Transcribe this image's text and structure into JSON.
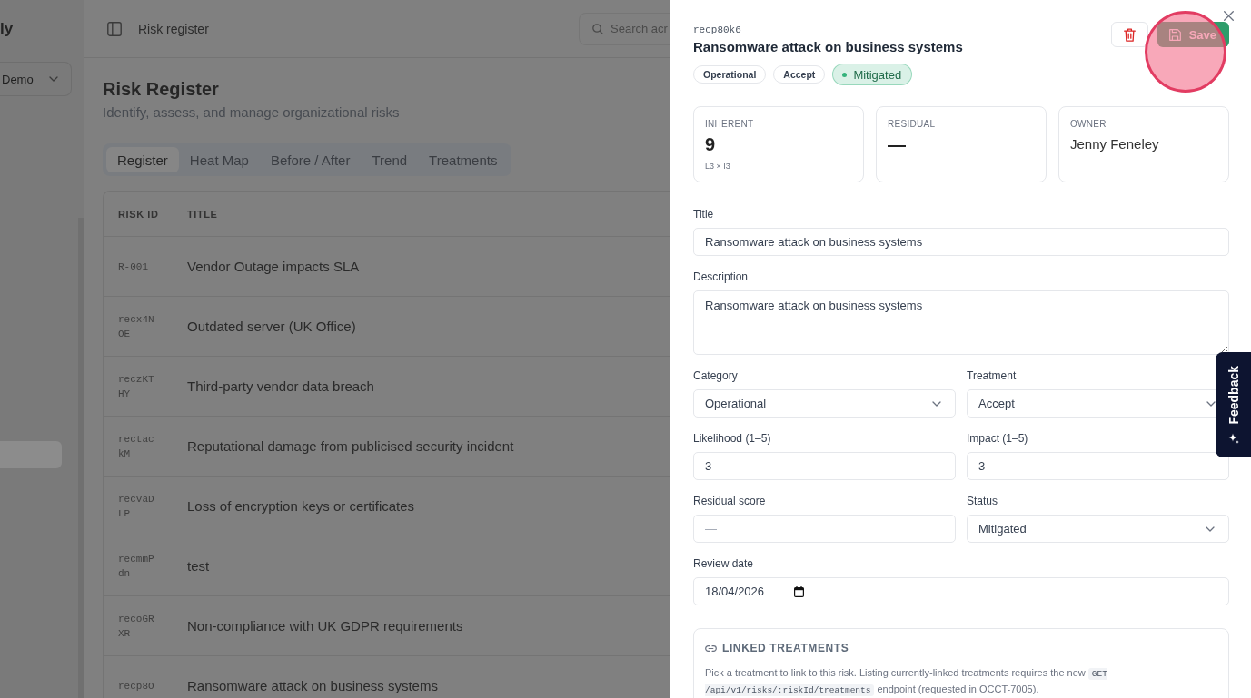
{
  "sidebar": {
    "brand": "ly",
    "workspace_select": {
      "value": "Demo"
    },
    "items": [
      {
        "selected": true
      }
    ]
  },
  "header": {
    "title": "Risk register",
    "search": {
      "placeholder": "Search acr"
    }
  },
  "page": {
    "title": "Risk Register",
    "subtitle": "Identify, assess, and manage organizational risks"
  },
  "tabs": [
    {
      "label": "Register",
      "selected": true
    },
    {
      "label": "Heat Map",
      "selected": false
    },
    {
      "label": "Before / After",
      "selected": false
    },
    {
      "label": "Trend",
      "selected": false
    },
    {
      "label": "Treatments",
      "selected": false
    }
  ],
  "table": {
    "columns": [
      "RISK ID",
      "TITLE"
    ],
    "rows": [
      {
        "risk_id": "R-001",
        "title": "Vendor Outage impacts SLA"
      },
      {
        "risk_id": "recx4NOE",
        "title": "Outdated server (UK Office)"
      },
      {
        "risk_id": "reczKTHY",
        "title": "Third-party vendor data breach"
      },
      {
        "risk_id": "rectackM",
        "title": "Reputational damage from publicised security incident"
      },
      {
        "risk_id": "recvaDLP",
        "title": "Loss of encryption keys or certificates"
      },
      {
        "risk_id": "recmmPdn",
        "title": "test"
      },
      {
        "risk_id": "recoGRXR",
        "title": "Non-compliance with UK GDPR requirements"
      },
      {
        "risk_id": "recp8O",
        "title": "Ransomware attack on business systems"
      }
    ]
  },
  "drawer": {
    "record_id": "recp80k6",
    "title": "Ransomware attack on business systems",
    "badges": [
      {
        "kind": "outline",
        "label": "Operational"
      },
      {
        "kind": "outline",
        "label": "Accept"
      },
      {
        "kind": "status",
        "label": "Mitigated",
        "color": "#34b27b"
      }
    ],
    "actions": [
      {
        "kind": "delete"
      },
      {
        "kind": "save",
        "label": "Save"
      }
    ],
    "stats": [
      {
        "kind": "score",
        "label": "INHERENT",
        "value": "9",
        "detail": "L3 × I3"
      },
      {
        "kind": "score",
        "label": "RESIDUAL",
        "value": "—"
      },
      {
        "kind": "person",
        "label": "OWNER",
        "value": "Jenny Feneley"
      }
    ],
    "form": {
      "rows": [
        [
          {
            "kind": "text",
            "label": "Title",
            "value": "Ransomware attack on business systems"
          }
        ],
        [
          {
            "kind": "textarea",
            "label": "Description",
            "value": "Ransomware attack on business systems"
          }
        ],
        [
          {
            "kind": "select",
            "label": "Category",
            "value": "Operational"
          },
          {
            "kind": "select",
            "label": "Treatment",
            "value": "Accept"
          }
        ],
        [
          {
            "kind": "text",
            "label": "Likelihood (1–5)",
            "value": "3"
          },
          {
            "kind": "text",
            "label": "Impact (1–5)",
            "value": "3"
          }
        ],
        [
          {
            "kind": "text",
            "label": "Residual score",
            "placeholder": "—"
          },
          {
            "kind": "select",
            "label": "Status",
            "value": "Mitigated"
          }
        ],
        [
          {
            "kind": "date",
            "label": "Review date",
            "value": "18/04/2026"
          }
        ]
      ]
    },
    "linked_treatments": {
      "heading": "LINKED TREATMENTS",
      "text_before": "Pick a treatment to link to this risk. Listing currently-linked treatments requires the new",
      "code": "GET /api/v1/risks/:riskId/treatments",
      "text_after": "endpoint (requested in OCCT-7005)."
    }
  },
  "feedback": {
    "label": "Feedback"
  },
  "cursor": {
    "kind": "click-highlight"
  }
}
